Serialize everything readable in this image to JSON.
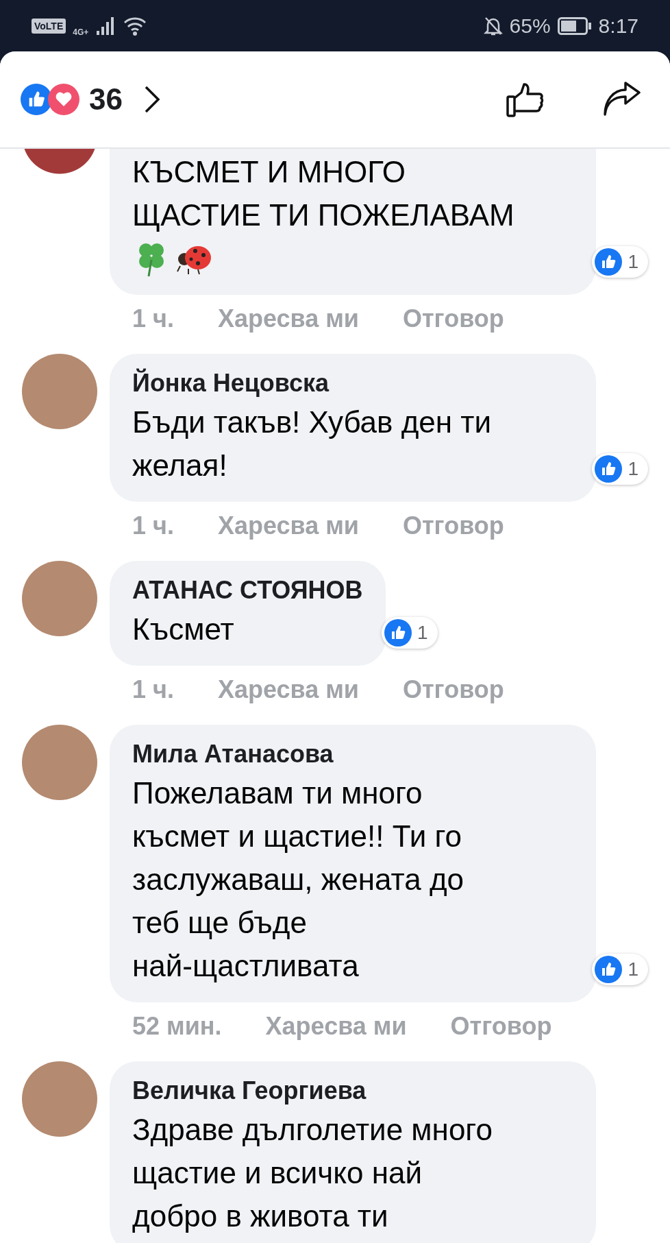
{
  "status_bar": {
    "volte": "VoLTE",
    "network": "4G+",
    "battery": "65%",
    "time": "8:17"
  },
  "header": {
    "reaction_count": "36"
  },
  "comments": [
    {
      "lines": [
        "КЪСМЕТ И МНОГО",
        "ЩАСТИЕ ТИ ПОЖЕЛАВАМ"
      ],
      "stickers": true,
      "likes": "1",
      "time": "1 ч.",
      "like_label": "Харесва ми",
      "reply_label": "Отговор"
    },
    {
      "author": "Йонка Нецовска",
      "lines": [
        "Бъди такъв! Хубав ден ти",
        "желая!"
      ],
      "likes": "1",
      "time": "1 ч.",
      "like_label": "Харесва ми",
      "reply_label": "Отговор"
    },
    {
      "author": "АТАНАС СТОЯНОВ",
      "lines": [
        "Късмет"
      ],
      "likes": "1",
      "time": "1 ч.",
      "like_label": "Харесва ми",
      "reply_label": "Отговор"
    },
    {
      "author": "Мила Атанасова",
      "lines": [
        "Пожелавам ти много",
        "късмет и щастие!! Ти го",
        "заслужаваш, жената до",
        "теб ще бъде",
        "най-щастливата"
      ],
      "likes": "1",
      "time": "52 мин.",
      "like_label": "Харесва ми",
      "reply_label": "Отговор"
    },
    {
      "author": "Величка Георгиева",
      "lines": [
        "Здраве дълголетие много",
        "щастие и всичко най",
        "добро в живота ти"
      ]
    }
  ]
}
